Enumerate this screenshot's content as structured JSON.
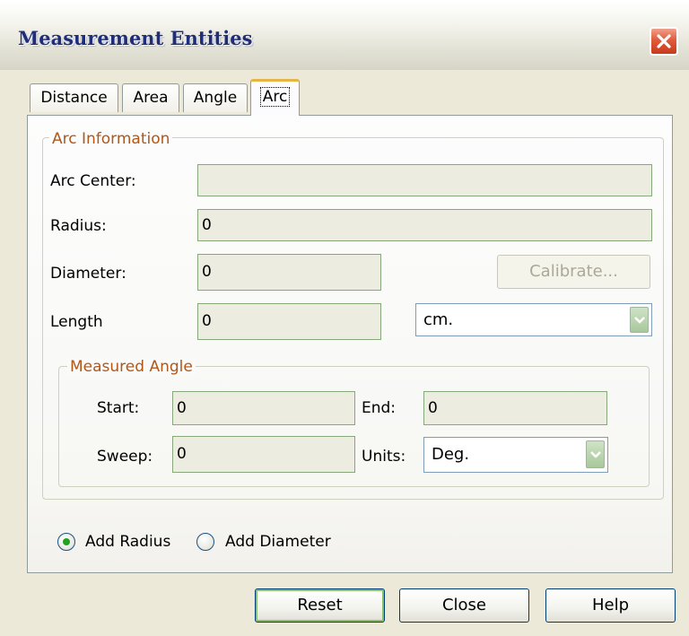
{
  "window": {
    "title": "Measurement Entities"
  },
  "tabs": [
    {
      "label": "Distance"
    },
    {
      "label": "Area"
    },
    {
      "label": "Angle"
    },
    {
      "label": "Arc",
      "active": true
    }
  ],
  "arc_info": {
    "legend": "Arc Information",
    "arc_center": {
      "label": "Arc Center:",
      "value": ""
    },
    "radius": {
      "label": "Radius:",
      "value": "0"
    },
    "diameter": {
      "label": "Diameter:",
      "value": "0"
    },
    "length": {
      "label": "Length",
      "value": "0"
    },
    "calibrate_label": "Calibrate...",
    "length_units": "cm."
  },
  "measured_angle": {
    "legend": "Measured Angle",
    "start": {
      "label": "Start:",
      "value": "0"
    },
    "end": {
      "label": "End:",
      "value": "0"
    },
    "sweep": {
      "label": "Sweep:",
      "value": "0"
    },
    "units": {
      "label": "Units:",
      "value": "Deg."
    }
  },
  "options": {
    "add_radius": "Add Radius",
    "add_diameter": "Add Diameter",
    "selected": "add_radius"
  },
  "buttons": {
    "reset": "Reset",
    "close": "Close",
    "help": "Help"
  },
  "colors": {
    "accent_orange": "#e5b645",
    "legend_text": "#b0571a",
    "title_text": "#1f2e7a",
    "close_red": "#d64a2a",
    "radio_green": "#21a121"
  }
}
